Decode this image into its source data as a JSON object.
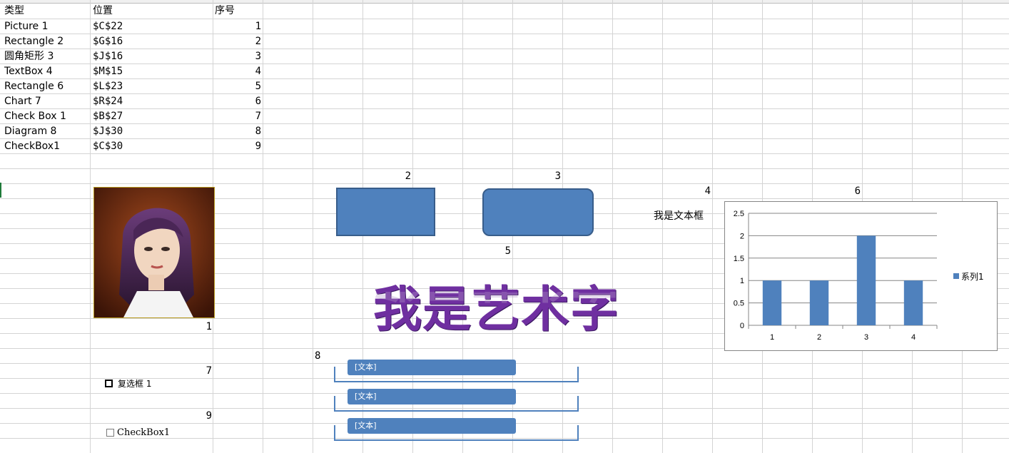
{
  "table": {
    "headers": [
      "类型",
      "位置",
      "序号"
    ],
    "rows": [
      {
        "type": "Picture 1",
        "pos": "$C$22",
        "idx": "1"
      },
      {
        "type": "Rectangle 2",
        "pos": "$G$16",
        "idx": "2"
      },
      {
        "type": "圆角矩形 3",
        "pos": "$J$16",
        "idx": "3"
      },
      {
        "type": "TextBox 4",
        "pos": "$M$15",
        "idx": "4"
      },
      {
        "type": "Rectangle 6",
        "pos": "$L$23",
        "idx": "5"
      },
      {
        "type": "Chart 7",
        "pos": "$R$24",
        "idx": "6"
      },
      {
        "type": "Check Box 1",
        "pos": "$B$27",
        "idx": "7"
      },
      {
        "type": "Diagram 8",
        "pos": "$J$30",
        "idx": "8"
      },
      {
        "type": "CheckBox1",
        "pos": "$C$30",
        "idx": "9"
      }
    ]
  },
  "labels": {
    "n1": "1",
    "n2": "2",
    "n3": "3",
    "n4": "4",
    "n5": "5",
    "n6": "6",
    "n7": "7",
    "n8": "8",
    "n9": "9"
  },
  "textbox": {
    "text": "我是文本框"
  },
  "wordart": {
    "text": "我是艺术字"
  },
  "checkbox_form": {
    "label": "复选框 1",
    "checked": false
  },
  "checkbox_activex": {
    "label": "CheckBox1",
    "checked": false
  },
  "diagram": {
    "items": [
      "[文本]",
      "[文本]",
      "[文本]"
    ]
  },
  "colors": {
    "shape_fill": "#4f81bd",
    "shape_border": "#385d8a",
    "wordart": "#6f2fa0",
    "series": "#4f81bd"
  },
  "chart_data": {
    "type": "bar",
    "categories": [
      "1",
      "2",
      "3",
      "4"
    ],
    "series": [
      {
        "name": "系列1",
        "values": [
          1,
          1,
          2,
          1
        ]
      }
    ],
    "ylim": [
      0,
      2.5
    ],
    "yticks": [
      "0",
      "0.5",
      "1",
      "1.5",
      "2",
      "2.5"
    ],
    "grid": true,
    "legend": "right"
  }
}
